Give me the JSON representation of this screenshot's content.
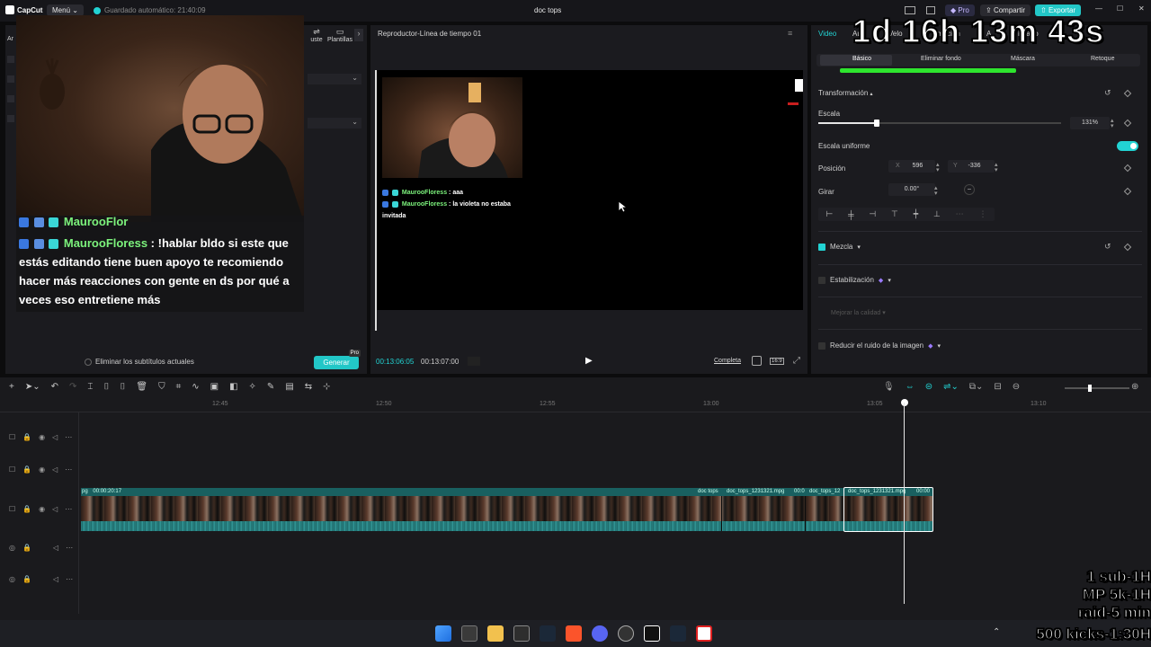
{
  "app": {
    "name": "CapCut",
    "menu_label": "Menú",
    "autosave": "Guardado automático: 21:40:09",
    "project_title": "doc tops",
    "pro_label": "Pro",
    "share_label": "Compartir",
    "export_label": "Exportar"
  },
  "left_panel": {
    "tab_partial_1": "Ar",
    "tab_adjust": "uste",
    "tab_templates": "Plantillas",
    "remove_subtitles_label": "Eliminar los subtítulos actuales",
    "generate_label": "Generar",
    "generate_badge": "Pro"
  },
  "stream_chat": {
    "partial_name": "MaurooFlor",
    "name": "MaurooFloress",
    "message": " : !hablar bldo si este que estás editando tiene buen apoyo te recomiendo hacer más reacciones con gente en ds por qué a veces eso entretiene más"
  },
  "player": {
    "title": "Reproductor-Línea de tiempo 01",
    "chat_lines": [
      {
        "name": "MaurooFloress",
        "text": " : aaa"
      },
      {
        "name": "MaurooFloress",
        "text": " : la violeta no estaba invitada"
      }
    ],
    "current_time": "00:13:06:05",
    "total_time": "00:13:07:00",
    "full_label": "Completa",
    "ratio_label": "16:9"
  },
  "inspector": {
    "tabs": [
      "Video",
      "Au",
      "Velo",
      "mación",
      "A",
      "ilizado"
    ],
    "subtabs": [
      "Básico",
      "Eliminar fondo",
      "Máscara",
      "Retoque"
    ],
    "transform_label": "Transformación",
    "scale_label": "Escala",
    "scale_value": "131%",
    "scale_fraction": 0.24,
    "uniform_scale_label": "Escala uniforme",
    "position_label": "Posición",
    "pos_x_label": "X",
    "pos_x": "596",
    "pos_y_label": "Y",
    "pos_y": "-336",
    "rotate_label": "Girar",
    "rotate_value": "0.00°",
    "rotate_dash": "–",
    "blend_label": "Mezcla",
    "stabilize_label": "Estabilización",
    "enhance_label": "Mejorar la calidad",
    "denoise_label": "Reducir el ruido de la imagen"
  },
  "timeline": {
    "ruler": [
      "12:45",
      "12:50",
      "12:55",
      "13:00",
      "13:05",
      "13:10"
    ],
    "main_clip_partial": "pg",
    "main_clip_time": "00:00:20:17",
    "clips": [
      "doc tops",
      "doc_tops_1231321.mpg",
      "00:0",
      "doc_tops_12",
      "doc_tops_1231321.mpg",
      "00:00"
    ]
  },
  "stream_overlay": {
    "timer": "1d 16h 13m 43s",
    "goals": [
      "1 sub-1H",
      "MP 5k-1H",
      "raid-5 min",
      "500 kicks-1:30H"
    ]
  },
  "colors": {
    "accent": "#22d3d3",
    "chat_name": "#7cf27c",
    "clip": "#1f6e6e",
    "progress_green": "#2ee52e"
  }
}
